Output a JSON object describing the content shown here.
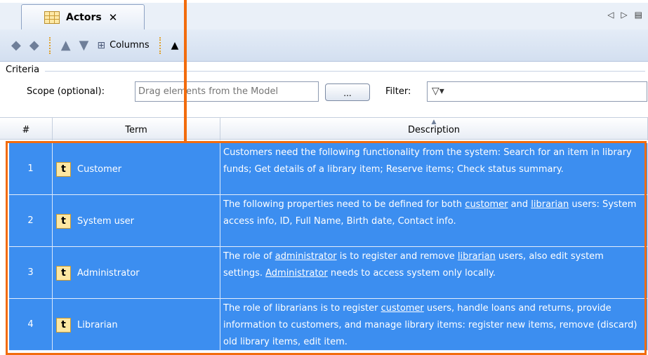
{
  "tab": {
    "title": "Actors",
    "close": "✕"
  },
  "tab_tools": [
    "◁",
    "▷",
    "▤"
  ],
  "toolbar": {
    "columns_label": "Columns"
  },
  "criteria": {
    "legend": "Criteria",
    "scope_label": "Scope (optional):",
    "scope_placeholder": "Drag elements from the Model",
    "browse_label": "...",
    "filter_label": "Filter:"
  },
  "table": {
    "headers": {
      "num": "#",
      "term": "Term",
      "desc": "Description"
    },
    "rows": [
      {
        "num": "1",
        "term": "Customer",
        "desc": [
          {
            "t": "Customers need the following functionality from the system: Search for an item in library funds; Get details of a library item; Reserve items; Check status summary."
          }
        ]
      },
      {
        "num": "2",
        "term": "System user",
        "desc": [
          {
            "t": "The following properties need to be defined for both "
          },
          {
            "t": "customer",
            "link": true
          },
          {
            "t": " and "
          },
          {
            "t": "librarian",
            "link": true
          },
          {
            "t": " users: System access info, ID, Full Name, Birth date, Contact info."
          }
        ]
      },
      {
        "num": "3",
        "term": "Administrator",
        "desc": [
          {
            "t": "The role of "
          },
          {
            "t": "administrator",
            "link": true
          },
          {
            "t": " is to register and remove "
          },
          {
            "t": "librarian",
            "link": true
          },
          {
            "t": " users, also edit system settings. "
          },
          {
            "t": "Administrator",
            "link": true
          },
          {
            "t": " needs to access system only locally."
          }
        ]
      },
      {
        "num": "4",
        "term": "Librarian",
        "desc": [
          {
            "t": "The role of librarians is to register "
          },
          {
            "t": "customer",
            "link": true
          },
          {
            "t": " users, handle loans and returns, provide information to customers, and manage library items: register new items, remove (discard) old library items, edit item."
          }
        ]
      }
    ]
  },
  "colors": {
    "selection": "#3c8ef0",
    "highlight": "#f26c0d",
    "toolbar": "#dde6f3"
  }
}
